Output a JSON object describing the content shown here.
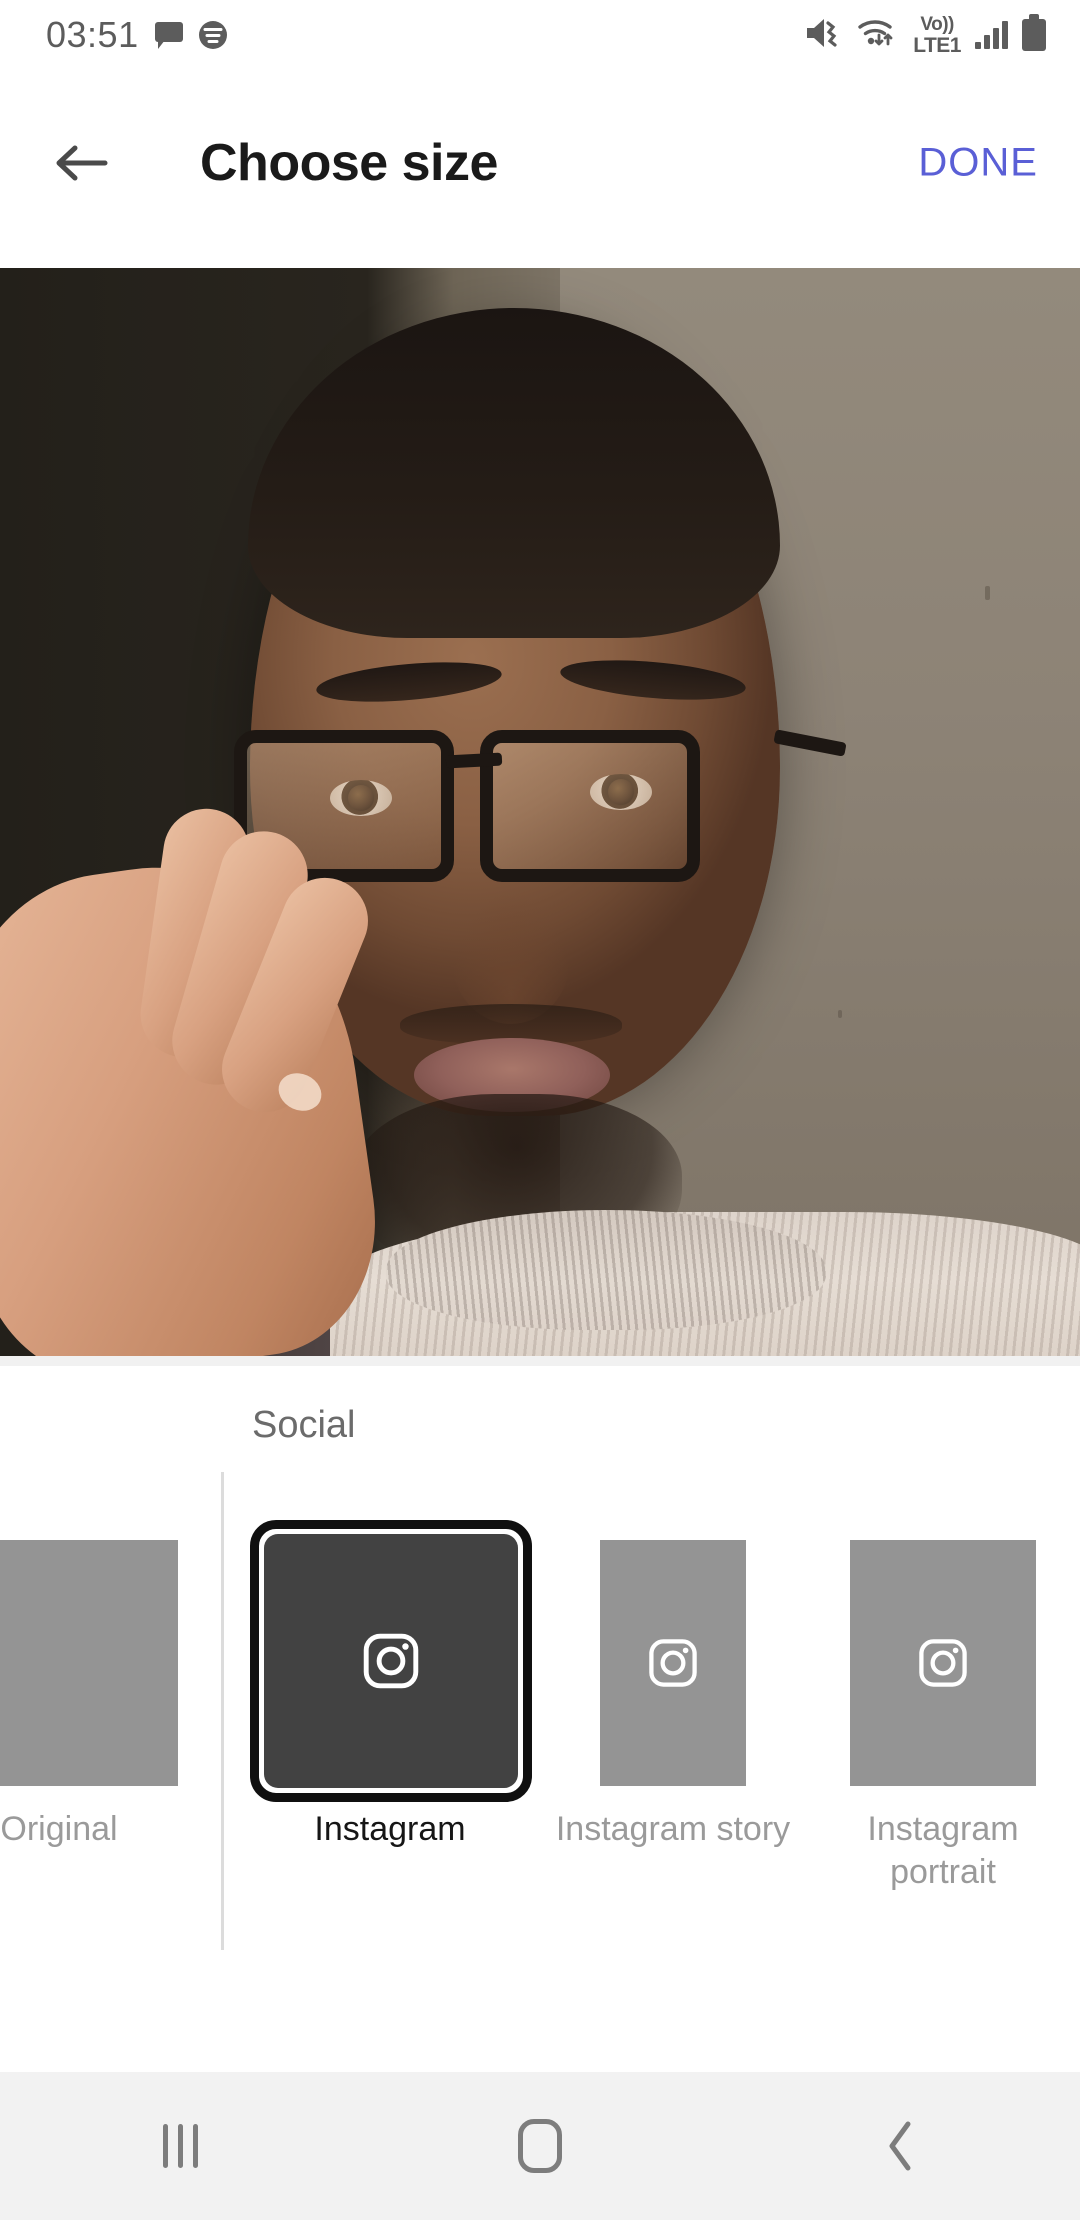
{
  "status_bar": {
    "clock": "03:51",
    "left_icons": [
      "message-bubble-icon",
      "spotify-icon"
    ],
    "right_icons": [
      "vibrate-mute-icon",
      "wifi-icon",
      "volte-icon",
      "signal-bars-icon",
      "battery-icon"
    ],
    "network_label_top": "Vo))",
    "network_label_bottom": "LTE1"
  },
  "header": {
    "back_icon": "back-arrow-icon",
    "title": "Choose size",
    "done_label": "DONE",
    "done_color": "#5a5fd6"
  },
  "photo": {
    "alt": "portrait-photo-preview"
  },
  "picker": {
    "group_label": "Social",
    "tiles": [
      {
        "id": "original",
        "label": "Original",
        "selected": false,
        "icon": null,
        "shape": "portrait-clipped"
      },
      {
        "id": "instagram",
        "label": "Instagram",
        "selected": true,
        "icon": "instagram-icon",
        "shape": "square"
      },
      {
        "id": "story",
        "label": "Instagram story",
        "selected": false,
        "icon": "instagram-icon",
        "shape": "tall"
      },
      {
        "id": "portrait",
        "label": "Instagram portrait",
        "selected": false,
        "icon": "instagram-icon",
        "shape": "portrait"
      }
    ],
    "selected_tile_bg": "#424242",
    "unselected_tile_bg": "#949494"
  },
  "nav_bar": {
    "recents_icon": "recents-icon",
    "home_icon": "home-icon",
    "back_icon": "nav-back-chevron-icon"
  }
}
